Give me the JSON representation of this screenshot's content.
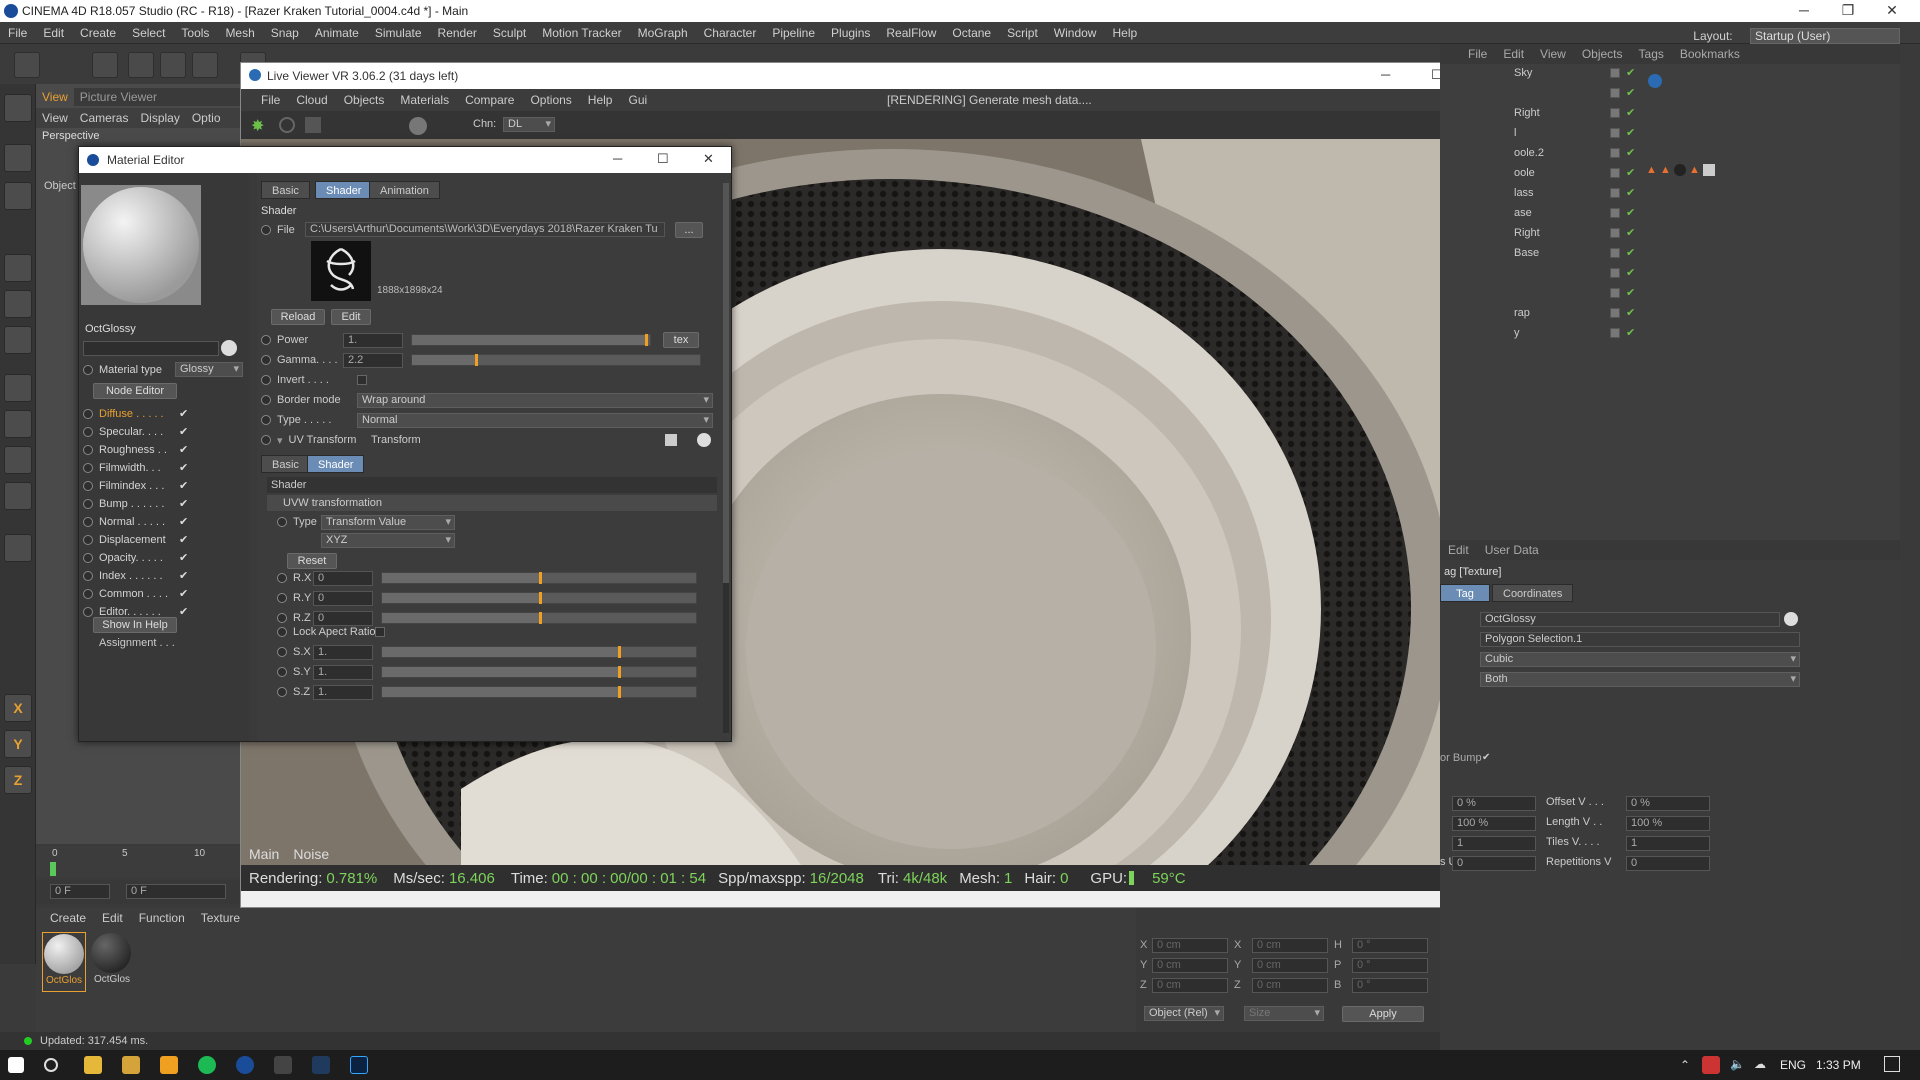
{
  "app": {
    "title": "CINEMA 4D R18.057 Studio (RC - R18) - [Razer Kraken Tutorial_0004.c4d *] - Main",
    "menu": [
      "File",
      "Edit",
      "Create",
      "Select",
      "Tools",
      "Mesh",
      "Snap",
      "Animate",
      "Simulate",
      "Render",
      "Sculpt",
      "Motion Tracker",
      "MoGraph",
      "Character",
      "Pipeline",
      "Plugins",
      "RealFlow",
      "Octane",
      "Script",
      "Window",
      "Help"
    ],
    "layout_label": "Layout:",
    "layout_value": "Startup (User)"
  },
  "viewport": {
    "tabs": [
      "View",
      "Picture Viewer"
    ],
    "menu": [
      "View",
      "Cameras",
      "Display",
      "Optio"
    ],
    "camera": "Perspective",
    "object_label": "Object",
    "timeline_ticks": [
      "0",
      "5",
      "10"
    ],
    "frame_start": "0 F",
    "frame_field": "0 F"
  },
  "live_viewer": {
    "title": "Live Viewer VR 3.06.2 (31 days left)",
    "menu": [
      "File",
      "Cloud",
      "Objects",
      "Materials",
      "Compare",
      "Options",
      "Help",
      "Gui"
    ],
    "status_message": "[RENDERING] Generate mesh data....",
    "chn_label": "Chn:",
    "chn_value": "DL",
    "bottom_tabs": [
      "Main",
      "Noise"
    ],
    "stats": {
      "rendering_label": "Rendering:",
      "rendering_value": "0.781%",
      "mssec_label": "Ms/sec:",
      "mssec_value": "16.406",
      "time_label": "Time:",
      "time_value": "00 : 00 : 00/00 : 01 : 54",
      "spp_label": "Spp/maxspp:",
      "spp_value": "16/2048",
      "tri_label": "Tri:",
      "tri_value": "4k/48k",
      "mesh_label": "Mesh:",
      "mesh_value": "1",
      "hair_label": "Hair:",
      "hair_value": "0",
      "gpu_label": "GPU:",
      "gpu_temp": "59°C"
    }
  },
  "material_editor": {
    "title": "Material Editor",
    "material_name": "OctGlossy",
    "material_type_label": "Material type",
    "material_type_value": "Glossy",
    "node_editor_label": "Node Editor",
    "channels": [
      {
        "label": "Diffuse . . . . .",
        "active": true
      },
      {
        "label": "Specular. . . .",
        "active": false
      },
      {
        "label": "Roughness . .",
        "active": false
      },
      {
        "label": "Filmwidth. . .",
        "active": false
      },
      {
        "label": "Filmindex . . .",
        "active": false
      },
      {
        "label": "Bump . . . . . .",
        "active": false
      },
      {
        "label": "Normal . . . . .",
        "active": false
      },
      {
        "label": "Displacement",
        "active": false
      },
      {
        "label": "Opacity. . . . .",
        "active": false
      },
      {
        "label": "Index . . . . . .",
        "active": false
      },
      {
        "label": "Common . . . .",
        "active": false
      },
      {
        "label": "Editor. . . . . .",
        "active": false
      }
    ],
    "check_glyph": "✔",
    "show_in_help": "Show In Help",
    "assignment": "Assignment . . .",
    "tabs": [
      "Basic",
      "Shader",
      "Animation"
    ],
    "section_shader": "Shader",
    "file_label": "File",
    "file_path": "C:\\Users\\Arthur\\Documents\\Work\\3D\\Everydays 2018\\Razer Kraken Tu",
    "file_browse": "...",
    "image_info": "1888x1898x24",
    "reload": "Reload",
    "edit": "Edit",
    "power_label": "Power",
    "power_value": "1.",
    "power_level": 0.98,
    "tex_label": "tex",
    "gamma_label": "Gamma. . . .",
    "gamma_value": "2.2",
    "gamma_level": 0.22,
    "invert_label": "Invert . . . .",
    "border_label": "Border mode",
    "border_value": "Wrap around",
    "type_label": "Type . . . . .",
    "type_value": "Normal",
    "uv_label": "UV Transform",
    "uv_value": "Transform",
    "subtabs": [
      "Basic",
      "Shader"
    ],
    "sub_section": "Shader",
    "uvw_label": "UVW transformation",
    "uvw_type_label": "Type",
    "uvw_type_value": "Transform Value",
    "uvw_order": "XYZ",
    "reset": "Reset",
    "rot": [
      {
        "label": "R.X",
        "value": "0",
        "level": 0.5
      },
      {
        "label": "R.Y",
        "value": "0",
        "level": 0.5
      },
      {
        "label": "R.Z",
        "value": "0",
        "level": 0.5
      }
    ],
    "lock_aspect": "Lock Apect Ratio",
    "scale": [
      {
        "label": "S.X",
        "value": "1.",
        "level": 0.75
      },
      {
        "label": "S.Y",
        "value": "1.",
        "level": 0.75
      },
      {
        "label": "S.Z",
        "value": "1.",
        "level": 0.75
      }
    ]
  },
  "object_manager": {
    "menu": [
      "File",
      "Edit",
      "View",
      "Objects",
      "Tags",
      "Bookmarks"
    ],
    "rows": [
      "Sky",
      "",
      "Right",
      "l",
      "oole.2",
      "oole",
      "lass",
      "ase",
      "Right",
      "Base",
      "",
      "",
      "rap",
      "y"
    ]
  },
  "attributes": {
    "menu": [
      "Edit",
      "User Data"
    ],
    "title": "ag [Texture]",
    "tabs": [
      "Tag",
      "Coordinates"
    ],
    "material": "OctGlossy",
    "selection": "Polygon Selection.1",
    "projection": "Cubic",
    "side": "Both",
    "bump_label": "or Bump",
    "offset_u": "0 %",
    "offset_v_label": "Offset V . . .",
    "offset_v": "0 %",
    "length_u": "100 %",
    "length_v_label": "Length V . .",
    "length_v": "100 %",
    "tiles_u": "1",
    "tiles_v_label": "Tiles V. . . .",
    "tiles_v": "1",
    "rep_u_label": "s U",
    "rep_u": "0",
    "rep_v_label": "Repetitions V",
    "rep_v": "0"
  },
  "material_manager": {
    "menu": [
      "Create",
      "Edit",
      "Function",
      "Texture"
    ],
    "materials": [
      "OctGlos",
      "OctGlos"
    ]
  },
  "coordinates": {
    "rows": [
      {
        "a": "X",
        "av": "0 cm",
        "b": "X",
        "bv": "0 cm",
        "c": "H",
        "cv": "0 °"
      },
      {
        "a": "Y",
        "av": "0 cm",
        "b": "Y",
        "bv": "0 cm",
        "c": "P",
        "cv": "0 °"
      },
      {
        "a": "Z",
        "av": "0 cm",
        "b": "Z",
        "bv": "0 cm",
        "c": "B",
        "cv": "0 °"
      }
    ],
    "mode": "Object (Rel)",
    "size": "Size",
    "apply": "Apply"
  },
  "status": {
    "text": "Updated: 317.454 ms."
  },
  "taskbar": {
    "lang": "ENG",
    "time": "1:33 PM"
  },
  "colors": {
    "accent": "#e8a032",
    "green": "#7ed35b",
    "selected_tab": "#6b8cb4"
  }
}
